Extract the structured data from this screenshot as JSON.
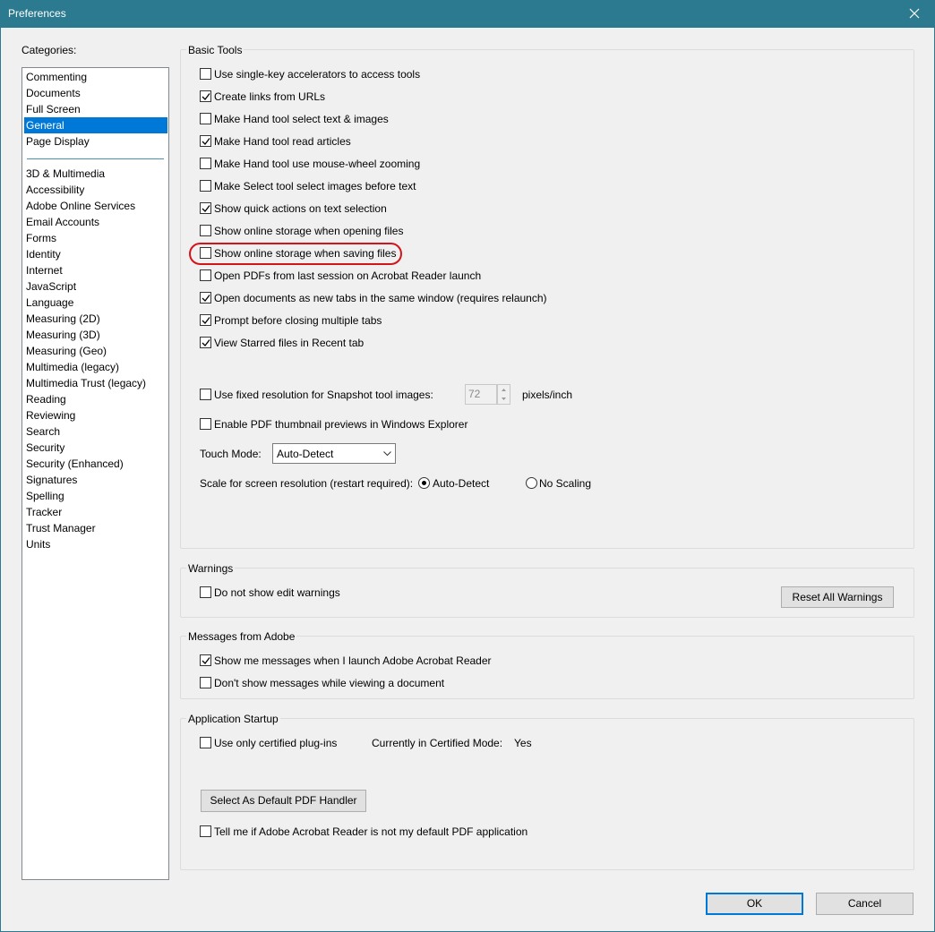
{
  "window": {
    "title": "Preferences"
  },
  "categories": {
    "label": "Categories:",
    "top": [
      "Commenting",
      "Documents",
      "Full Screen",
      "General",
      "Page Display"
    ],
    "selected": "General",
    "bottom": [
      "3D & Multimedia",
      "Accessibility",
      "Adobe Online Services",
      "Email Accounts",
      "Forms",
      "Identity",
      "Internet",
      "JavaScript",
      "Language",
      "Measuring (2D)",
      "Measuring (3D)",
      "Measuring (Geo)",
      "Multimedia (legacy)",
      "Multimedia Trust (legacy)",
      "Reading",
      "Reviewing",
      "Search",
      "Security",
      "Security (Enhanced)",
      "Signatures",
      "Spelling",
      "Tracker",
      "Trust Manager",
      "Units"
    ]
  },
  "basic_tools": {
    "title": "Basic Tools",
    "options": [
      {
        "label": "Use single-key accelerators to access tools",
        "checked": false
      },
      {
        "label": "Create links from URLs",
        "checked": true
      },
      {
        "label": "Make Hand tool select text & images",
        "checked": false
      },
      {
        "label": "Make Hand tool read articles",
        "checked": true
      },
      {
        "label": "Make Hand tool use mouse-wheel zooming",
        "checked": false
      },
      {
        "label": "Make Select tool select images before text",
        "checked": false
      },
      {
        "label": "Show quick actions on text selection",
        "checked": true
      },
      {
        "label": "Show online storage when opening files",
        "checked": false
      },
      {
        "label": "Show online storage when saving files",
        "checked": false
      },
      {
        "label": "Open PDFs from last session on Acrobat Reader launch",
        "checked": false
      },
      {
        "label": "Open documents as new tabs in the same window (requires relaunch)",
        "checked": true
      },
      {
        "label": "Prompt before closing multiple tabs",
        "checked": true
      },
      {
        "label": "View Starred files in Recent tab",
        "checked": true
      }
    ],
    "snapshot": {
      "label": "Use fixed resolution for Snapshot tool images:",
      "checked": false,
      "value": "72",
      "unit": "pixels/inch"
    },
    "thumbnail": {
      "label": "Enable PDF thumbnail previews in Windows Explorer",
      "checked": false
    },
    "touch_mode": {
      "label": "Touch Mode:",
      "value": "Auto-Detect"
    },
    "scale": {
      "label": "Scale for screen resolution (restart required):",
      "option1": "Auto-Detect",
      "option2": "No Scaling",
      "selected": "Auto-Detect"
    }
  },
  "warnings": {
    "title": "Warnings",
    "option": {
      "label": "Do not show edit warnings",
      "checked": false
    },
    "reset_button": "Reset All Warnings"
  },
  "messages": {
    "title": "Messages from Adobe",
    "options": [
      {
        "label": "Show me messages when I launch Adobe Acrobat Reader",
        "checked": true
      },
      {
        "label": "Don't show messages while viewing a document",
        "checked": false
      }
    ]
  },
  "startup": {
    "title": "Application Startup",
    "certified": {
      "label": "Use only certified plug-ins",
      "checked": false
    },
    "certified_mode_label": "Currently in Certified Mode:",
    "certified_mode_value": "Yes",
    "default_handler_button": "Select As Default PDF Handler",
    "tell_me": {
      "label": "Tell me if Adobe Acrobat Reader is not my default PDF application",
      "checked": false
    }
  },
  "footer": {
    "ok": "OK",
    "cancel": "Cancel"
  },
  "colors": {
    "titlebar": "#2b7a8f",
    "selection": "#0078d7",
    "highlight": "#d3141b"
  }
}
